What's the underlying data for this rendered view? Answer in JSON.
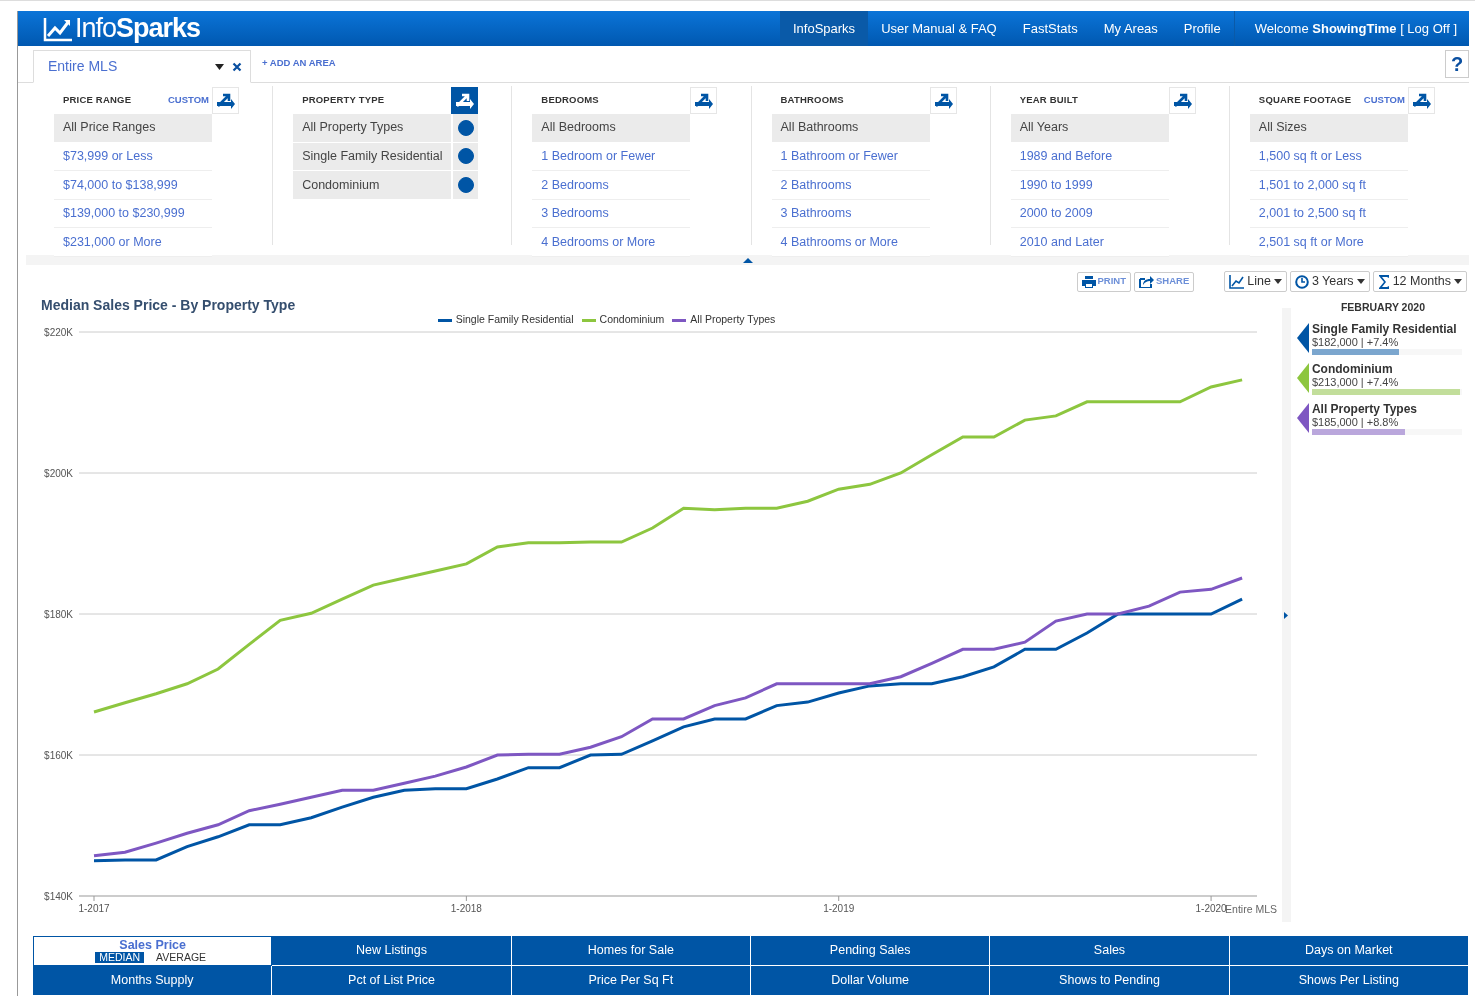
{
  "brand": {
    "light": "Info",
    "bold": "Sparks"
  },
  "nav": [
    {
      "label": "InfoSparks",
      "selected": true
    },
    {
      "label": "User Manual & FAQ",
      "selected": false
    },
    {
      "label": "FastStats",
      "selected": false
    },
    {
      "label": "My Areas",
      "selected": false
    },
    {
      "label": "Profile",
      "selected": false
    }
  ],
  "welcome": {
    "prefix": "Welcome",
    "user": "ShowingTime",
    "action": "[ Log Off ]"
  },
  "area_tab": {
    "label": "Entire MLS",
    "add_link": "+ ADD AN AREA",
    "help": "?"
  },
  "filters": [
    {
      "title": "PRICE RANGE",
      "custom": "CUSTOM",
      "active": false,
      "kind": "single",
      "items": [
        {
          "label": "All Price Ranges",
          "selected": true
        },
        {
          "label": "$73,999 or Less",
          "selected": false
        },
        {
          "label": "$74,000 to $138,999",
          "selected": false
        },
        {
          "label": "$139,000 to $230,999",
          "selected": false
        },
        {
          "label": "$231,000 or More",
          "selected": false
        }
      ]
    },
    {
      "title": "PROPERTY TYPE",
      "active": true,
      "kind": "multi",
      "items": [
        {
          "label": "All Property Types",
          "selected": true
        },
        {
          "label": "Single Family Residential",
          "selected": true
        },
        {
          "label": "Condominium",
          "selected": true
        }
      ]
    },
    {
      "title": "BEDROOMS",
      "active": false,
      "kind": "single",
      "items": [
        {
          "label": "All Bedrooms",
          "selected": true
        },
        {
          "label": "1 Bedroom or Fewer",
          "selected": false
        },
        {
          "label": "2 Bedrooms",
          "selected": false
        },
        {
          "label": "3 Bedrooms",
          "selected": false
        },
        {
          "label": "4 Bedrooms or More",
          "selected": false
        }
      ]
    },
    {
      "title": "BATHROOMS",
      "active": false,
      "kind": "single",
      "items": [
        {
          "label": "All Bathrooms",
          "selected": true
        },
        {
          "label": "1 Bathroom or Fewer",
          "selected": false
        },
        {
          "label": "2 Bathrooms",
          "selected": false
        },
        {
          "label": "3 Bathrooms",
          "selected": false
        },
        {
          "label": "4 Bathrooms or More",
          "selected": false
        }
      ]
    },
    {
      "title": "YEAR BUILT",
      "active": false,
      "kind": "single",
      "items": [
        {
          "label": "All Years",
          "selected": true
        },
        {
          "label": "1989 and Before",
          "selected": false
        },
        {
          "label": "1990 to 1999",
          "selected": false
        },
        {
          "label": "2000 to 2009",
          "selected": false
        },
        {
          "label": "2010 and Later",
          "selected": false
        }
      ]
    },
    {
      "title": "SQUARE FOOTAGE",
      "custom": "CUSTOM",
      "active": false,
      "kind": "single",
      "items": [
        {
          "label": "All Sizes",
          "selected": true
        },
        {
          "label": "1,500 sq ft or Less",
          "selected": false
        },
        {
          "label": "1,501 to 2,000 sq ft",
          "selected": false
        },
        {
          "label": "2,001 to 2,500 sq ft",
          "selected": false
        },
        {
          "label": "2,501 sq ft or More",
          "selected": false
        }
      ]
    }
  ],
  "toolbar": {
    "print": "PRINT",
    "share": "SHARE",
    "chart_type": "Line",
    "range": "3 Years",
    "rolling": "12 Months"
  },
  "chart": {
    "chart_data": {
      "type": "line",
      "title": "Median Sales Price - By Property Type",
      "categories": [
        "1-2017",
        null,
        null,
        null,
        null,
        null,
        null,
        null,
        null,
        null,
        null,
        null,
        "1-2018",
        null,
        null,
        null,
        null,
        null,
        null,
        null,
        null,
        null,
        null,
        null,
        "1-2019",
        null,
        null,
        null,
        null,
        null,
        null,
        null,
        null,
        null,
        null,
        null,
        "1-2020",
        null
      ],
      "ylim": [
        140,
        220
      ],
      "grid": true,
      "legend": true,
      "yticks": [
        {
          "value": 140,
          "label": "$140K"
        },
        {
          "value": 160,
          "label": "$160K"
        },
        {
          "value": 180,
          "label": "$180K"
        },
        {
          "value": 200,
          "label": "$200K"
        },
        {
          "value": 220,
          "label": "$220K"
        }
      ],
      "series": [
        {
          "name": "Single Family Residential",
          "color": "#0055a5",
          "values": [
            145.0,
            145.1,
            145.1,
            147.0,
            148.4,
            150.1,
            150.1,
            151.1,
            152.6,
            154.0,
            155.0,
            155.2,
            155.2,
            156.6,
            158.2,
            158.2,
            160.0,
            160.1,
            162.0,
            164.0,
            165.1,
            165.1,
            167.0,
            167.5,
            168.8,
            169.8,
            170.1,
            170.1,
            171.1,
            172.5,
            175.0,
            175.0,
            177.3,
            180.0,
            180.0,
            180.0,
            180.0,
            182.1
          ]
        },
        {
          "name": "Condominium",
          "color": "#8dc63f",
          "values": [
            166.1,
            167.4,
            168.7,
            170.1,
            172.2,
            175.7,
            179.1,
            180.1,
            182.1,
            184.1,
            185.1,
            186.1,
            187.1,
            189.5,
            190.1,
            190.1,
            190.2,
            190.2,
            192.2,
            195.0,
            194.8,
            195.0,
            195.0,
            196.0,
            197.7,
            198.4,
            200.0,
            202.6,
            205.1,
            205.1,
            207.5,
            208.1,
            210.1,
            210.1,
            210.1,
            210.1,
            212.2,
            213.2
          ]
        },
        {
          "name": "All Property Types",
          "color": "#7e57c2",
          "values": [
            145.7,
            146.2,
            147.5,
            148.9,
            150.1,
            152.1,
            153.0,
            154.0,
            155.0,
            155.0,
            156.0,
            157.0,
            158.3,
            160.0,
            160.1,
            160.1,
            161.1,
            162.6,
            165.1,
            165.1,
            167.0,
            168.1,
            170.1,
            170.1,
            170.1,
            170.1,
            171.1,
            173.0,
            175.0,
            175.0,
            176.0,
            179.0,
            180.0,
            180.0,
            181.1,
            183.1,
            183.5,
            185.1
          ]
        }
      ]
    },
    "area_label": "Entire MLS"
  },
  "summary": {
    "period": "FEBRUARY 2020",
    "entries": [
      {
        "name": "Single Family Residential",
        "value": "$182,000 | +7.4%",
        "color": "#0055a5",
        "level": 0.58
      },
      {
        "name": "Condominium",
        "value": "$213,000 | +7.4%",
        "color": "#8dc63f",
        "level": 0.99
      },
      {
        "name": "All Property Types",
        "value": "$185,000 | +8.8%",
        "color": "#7e57c2",
        "level": 0.62
      }
    ]
  },
  "metrics": [
    {
      "label": "Sales Price",
      "selected": true,
      "options": [
        {
          "label": "MEDIAN",
          "selected": true
        },
        {
          "label": "AVERAGE",
          "selected": false
        }
      ]
    },
    {
      "label": "New Listings",
      "selected": false
    },
    {
      "label": "Homes for Sale",
      "selected": false
    },
    {
      "label": "Pending Sales",
      "selected": false
    },
    {
      "label": "Sales",
      "selected": false
    },
    {
      "label": "Days on Market",
      "selected": false
    },
    {
      "label": "Months Supply",
      "selected": false
    },
    {
      "label": "Pct of List Price",
      "selected": false
    },
    {
      "label": "Price Per Sq Ft",
      "selected": false
    },
    {
      "label": "Dollar Volume",
      "selected": false
    },
    {
      "label": "Shows to Pending",
      "selected": false
    },
    {
      "label": "Shows Per Listing",
      "selected": false
    }
  ]
}
